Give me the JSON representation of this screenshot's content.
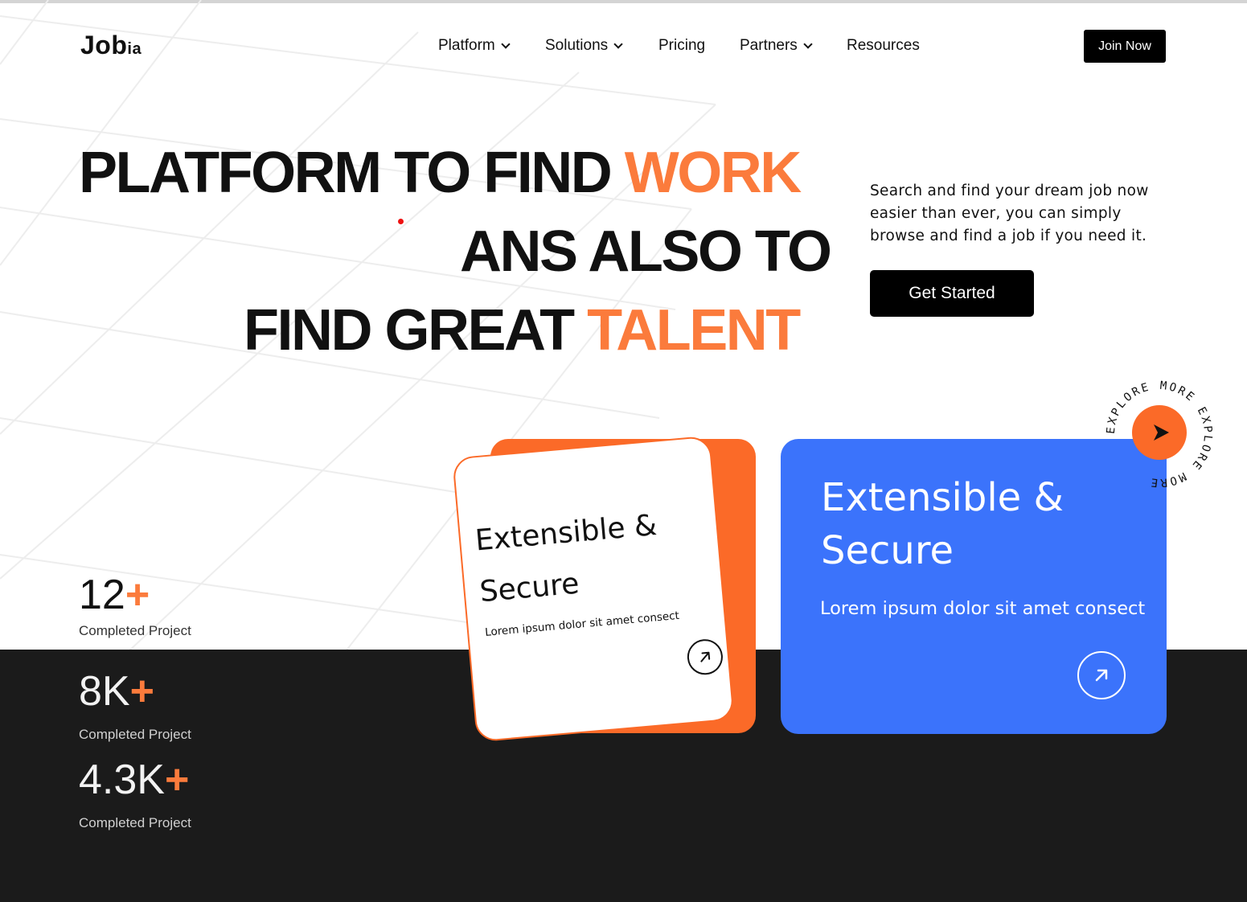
{
  "brand": {
    "name_main": "Job",
    "name_suffix": "ia"
  },
  "nav": {
    "items": [
      {
        "label": "Platform",
        "has_dropdown": true
      },
      {
        "label": "Solutions",
        "has_dropdown": true
      },
      {
        "label": "Pricing",
        "has_dropdown": false
      },
      {
        "label": "Partners",
        "has_dropdown": true
      },
      {
        "label": "Resources",
        "has_dropdown": false
      }
    ],
    "cta_label": "Join Now"
  },
  "hero": {
    "line1_black": "PLATFORM TO FIND ",
    "line1_orange": "WORK",
    "line2_black": "ANS ALSO TO",
    "line3_black": "FIND GREAT ",
    "line3_orange": "TALENT",
    "description": "Search and find your dream job now easier than ever, you can simply browse and find a job if you need it.",
    "cta_label": "Get Started"
  },
  "stats": [
    {
      "value": "12",
      "suffix": "+",
      "label": "Completed Project"
    },
    {
      "value": "8K",
      "suffix": "+",
      "label": "Completed Project"
    },
    {
      "value": "4.3K",
      "suffix": "+",
      "label": "Completed Project"
    }
  ],
  "cards": {
    "orange_card": {
      "title_line1": "Extensible &",
      "title_line2": "Secure",
      "subtitle": "Lorem ipsum dolor sit amet consect"
    },
    "blue_card": {
      "title_line1": "Extensible &",
      "title_line2": "Secure",
      "subtitle": "Lorem ipsum dolor sit amet consect"
    }
  },
  "explore_badge": {
    "ring_text": "EXPLORE MORE EXPLORE MORE"
  },
  "colors": {
    "accent_orange": "#fb7b3c",
    "card_orange": "#fb6a28",
    "card_blue": "#3b73fb",
    "dark_section": "#1b1b1b",
    "button_black": "#000000"
  },
  "icons": {
    "card_arrow": "arrow-up-right-icon",
    "explore_arrow": "cursor-arrow-icon",
    "dropdown": "chevron-down-icon"
  }
}
